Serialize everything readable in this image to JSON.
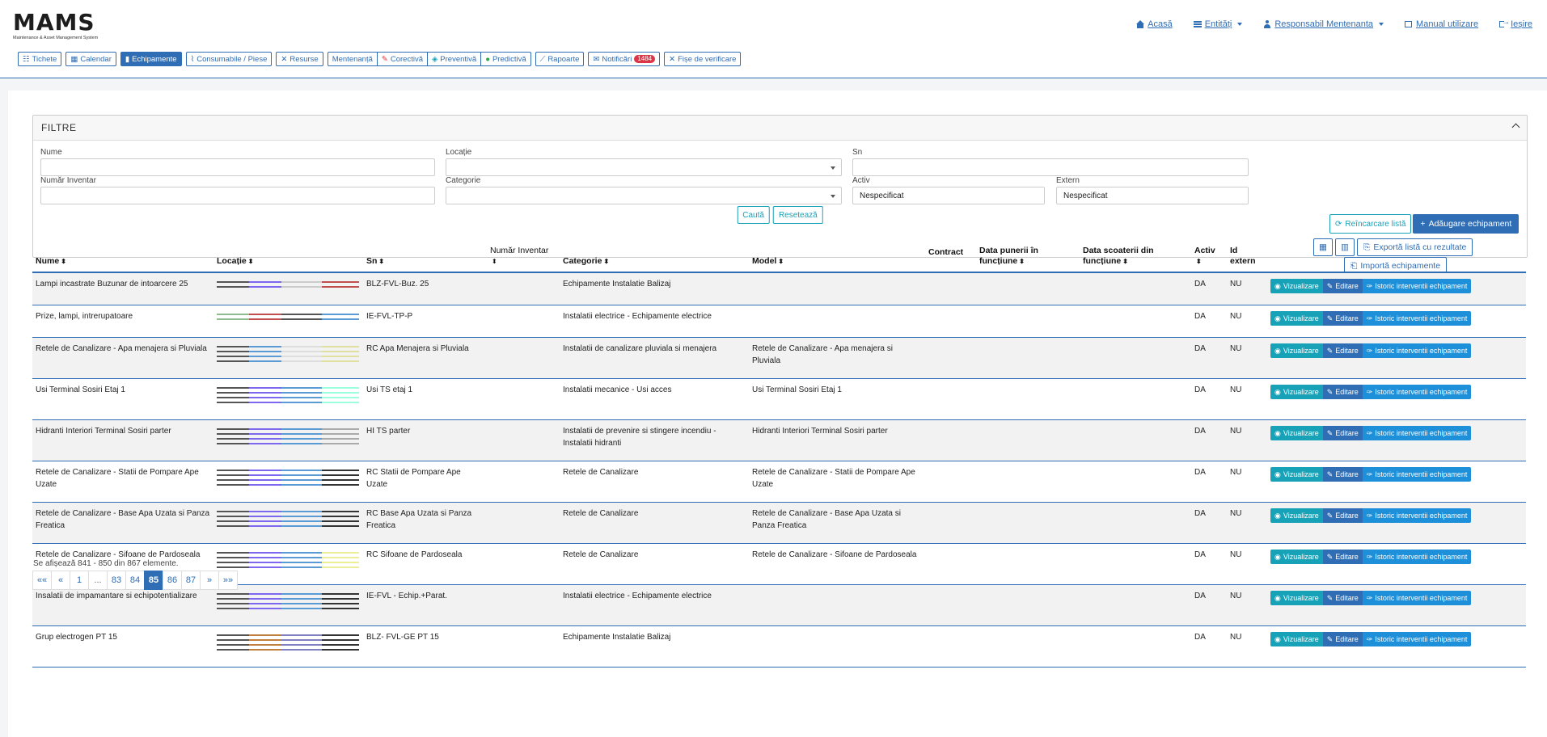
{
  "logo": {
    "text": "MAMS",
    "subtitle": "Maintenance & Asset Management System"
  },
  "topnav": [
    {
      "label": "Acasă",
      "icon": "home-icon"
    },
    {
      "label": "Entități",
      "icon": "list-icon",
      "dropdown": true
    },
    {
      "label": "Responsabil Mentenanta",
      "icon": "user-icon",
      "dropdown": true
    },
    {
      "label": "Manual utilizare",
      "icon": "book-icon"
    },
    {
      "label": "Ieșire",
      "icon": "sign-out-icon"
    }
  ],
  "modules": {
    "tichete": "Tichete",
    "calendar": "Calendar",
    "echipamente": "Echipamente",
    "consumabile": "Consumabile / Piese",
    "resurse": "Resurse",
    "mentenanta": "Mentenanță",
    "corectiva": "Corectivă",
    "preventiva": "Preventivă",
    "predictiva": "Predictivă",
    "rapoarte": "Rapoarte",
    "notificari": "Notificări",
    "notificari_count": "1484",
    "fise": "Fișe de verificare"
  },
  "filters": {
    "title": "FILTRE",
    "nume_label": "Nume",
    "nume_value": "",
    "locatie_label": "Locație",
    "locatie_value": "",
    "sn_label": "Sn",
    "sn_value": "",
    "inventar_label": "Număr Inventar",
    "inventar_value": "",
    "categorie_label": "Categorie",
    "categorie_value": "",
    "activ_label": "Activ",
    "activ_value": "Nespecificat",
    "extern_label": "Extern",
    "extern_value": "Nespecificat",
    "cauta": "Caută",
    "reseteaza": "Resetează"
  },
  "toolbar": {
    "reload": "Reîncarcare listă",
    "add": "Adăugare echipament",
    "export": "Exportă listă cu rezultate",
    "import": "Importă echipamente"
  },
  "columns": {
    "nume": "Nume",
    "locatie": "Locație",
    "sn": "Sn",
    "inventar": "Număr Inventar",
    "categorie": "Categorie",
    "model": "Model",
    "contract": "Contract",
    "data_punere": "Data punerii în funcțiune",
    "data_scoatere": "Data scoaterii din funcțiune",
    "activ": "Activ",
    "id_extern": "Id extern"
  },
  "actions": {
    "view": "Vizualizare",
    "edit": "Editare",
    "history": "Istoric interventii echipament"
  },
  "rows": [
    {
      "nume": "Lampi incastrate Buzunar de intoarcere 25",
      "sn": "BLZ-FVL-Buz. 25",
      "categorie": "Echipamente Instalatie Balizaj",
      "model": "",
      "activ": "DA",
      "extern": "NU"
    },
    {
      "nume": "Prize, lampi, intrerupatoare",
      "sn": "IE-FVL-TP-P",
      "categorie": "Instalatii electrice - Echipamente electrice",
      "model": "",
      "activ": "DA",
      "extern": "NU"
    },
    {
      "nume": "Retele de Canalizare - Apa menajera si Pluviala",
      "sn": "RC Apa Menajera si Pluviala",
      "categorie": "Instalatii de canalizare pluviala si menajera",
      "model": "Retele de Canalizare - Apa menajera si Pluviala",
      "activ": "DA",
      "extern": "NU"
    },
    {
      "nume": "Usi Terminal Sosiri Etaj 1",
      "sn": "Usi TS etaj 1",
      "categorie": "Instalatii mecanice - Usi acces",
      "model": "Usi Terminal Sosiri Etaj 1",
      "activ": "DA",
      "extern": "NU"
    },
    {
      "nume": "Hidranti Interiori Terminal Sosiri parter",
      "sn": "HI TS parter",
      "categorie": "Instalatii de prevenire si stingere incendiu - Instalatii hidranti",
      "model": "Hidranti Interiori Terminal Sosiri parter",
      "activ": "DA",
      "extern": "NU"
    },
    {
      "nume": "Retele de Canalizare - Statii de Pompare Ape Uzate",
      "sn": "RC Statii de Pompare Ape Uzate",
      "categorie": "Retele de Canalizare",
      "model": "Retele de Canalizare - Statii de Pompare Ape Uzate",
      "activ": "DA",
      "extern": "NU"
    },
    {
      "nume": "Retele de Canalizare - Base Apa Uzata si Panza Freatica",
      "sn": "RC Base Apa Uzata si Panza Freatica",
      "categorie": "Retele de Canalizare",
      "model": "Retele de Canalizare - Base Apa Uzata si Panza Freatica",
      "activ": "DA",
      "extern": "NU"
    },
    {
      "nume": "Retele de Canalizare - Sifoane de Pardoseala",
      "sn": "RC Sifoane de Pardoseala",
      "categorie": "Retele de Canalizare",
      "model": "Retele de Canalizare - Sifoane de Pardoseala",
      "activ": "DA",
      "extern": "NU"
    },
    {
      "nume": "Insalatii de impamantare si echipotentializare",
      "sn": "IE-FVL - Echip.+Parat.",
      "categorie": "Instalatii electrice - Echipamente electrice",
      "model": "",
      "activ": "DA",
      "extern": "NU"
    },
    {
      "nume": "Grup electrogen PT 15",
      "sn": "BLZ- FVL-GE PT 15",
      "categorie": "Echipamente Instalatie Balizaj",
      "model": "",
      "activ": "DA",
      "extern": "NU"
    }
  ],
  "info": "Se afișează 841 - 850 din 867 elemente.",
  "pagination": [
    "««",
    "«",
    "1",
    "...",
    "83",
    "84",
    "85",
    "86",
    "87",
    "»",
    "»»"
  ],
  "current_page": "85",
  "colors": {
    "primary": "#2f6db5",
    "info": "#17a2b8",
    "danger": "#dc3545"
  }
}
